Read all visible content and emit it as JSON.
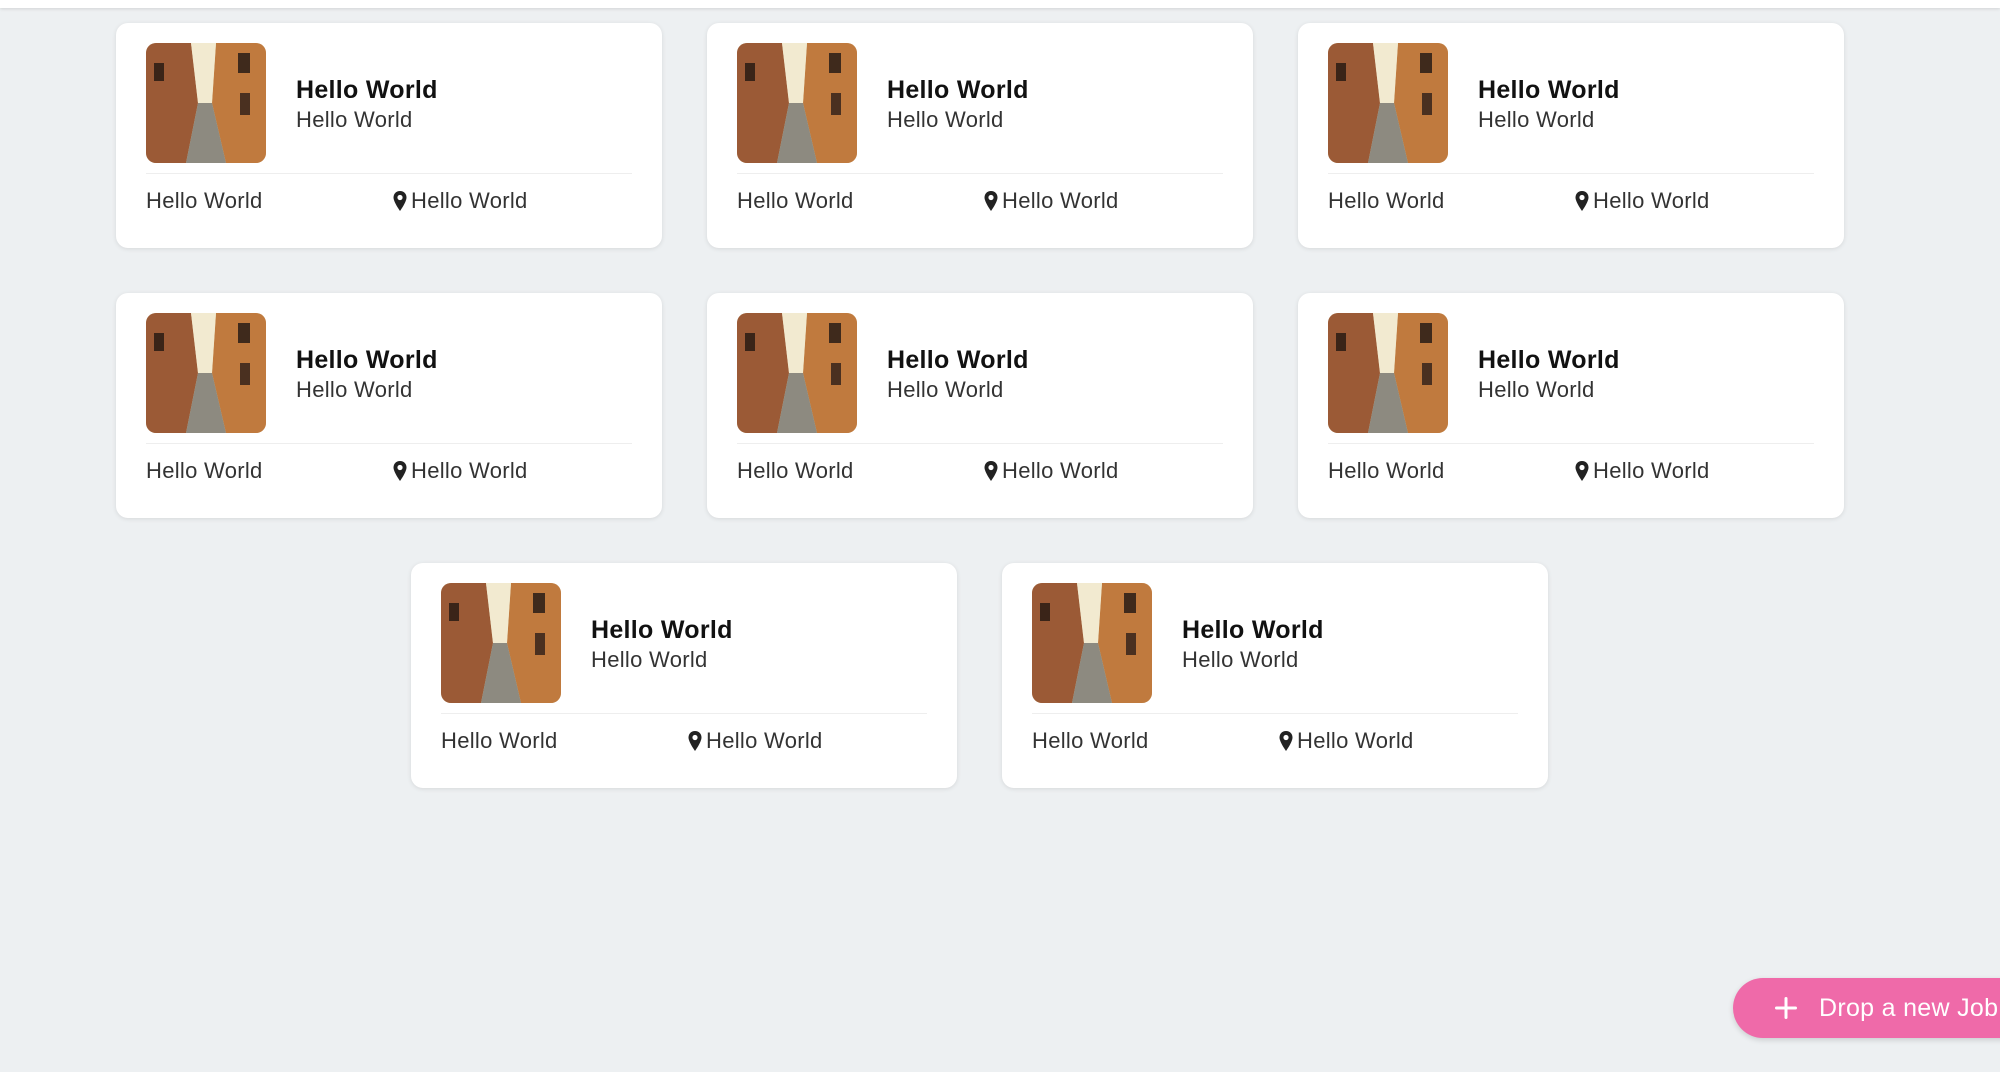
{
  "cards": [
    {
      "title": "Hello World",
      "subtitle": "Hello World",
      "meta": "Hello World",
      "location": "Hello World"
    },
    {
      "title": "Hello World",
      "subtitle": "Hello World",
      "meta": "Hello World",
      "location": "Hello World"
    },
    {
      "title": "Hello World",
      "subtitle": "Hello World",
      "meta": "Hello World",
      "location": "Hello World"
    },
    {
      "title": "Hello World",
      "subtitle": "Hello World",
      "meta": "Hello World",
      "location": "Hello World"
    },
    {
      "title": "Hello World",
      "subtitle": "Hello World",
      "meta": "Hello World",
      "location": "Hello World"
    },
    {
      "title": "Hello World",
      "subtitle": "Hello World",
      "meta": "Hello World",
      "location": "Hello World"
    },
    {
      "title": "Hello World",
      "subtitle": "Hello World",
      "meta": "Hello World",
      "location": "Hello World"
    },
    {
      "title": "Hello World",
      "subtitle": "Hello World",
      "meta": "Hello World",
      "location": "Hello World"
    }
  ],
  "icons": {
    "location": "map-pin-icon",
    "add": "plus-icon"
  },
  "fab": {
    "label": "Drop a new Job"
  },
  "colors": {
    "background": "#edf0f2",
    "card": "#ffffff",
    "fab": "#ef6aa9"
  }
}
